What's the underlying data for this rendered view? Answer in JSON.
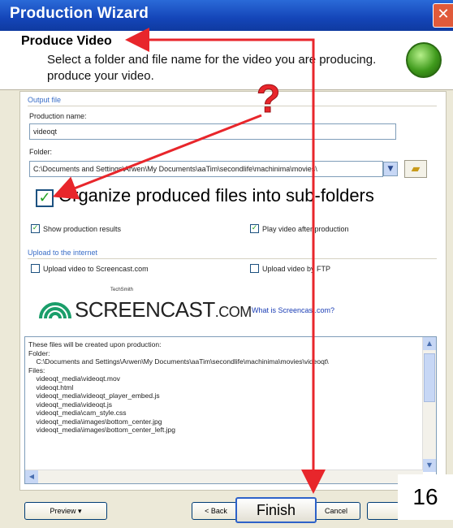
{
  "window": {
    "title": "Production Wizard",
    "close_glyph": "✕"
  },
  "header": {
    "title": "Produce Video",
    "subtitle": "Select a folder and file name for the video you are producing. produce your video."
  },
  "output_file": {
    "group_label": "Output file",
    "production_name_label": "Production name:",
    "production_name_value": "videoqt",
    "folder_label": "Folder:",
    "folder_value": "C:\\Documents and Settings\\Arwen\\My Documents\\aaTim\\secondlife\\machinima\\movies\\",
    "organize_label": "Organize produced files into sub-folders",
    "organize_checked": true,
    "show_results_label": "Show production results",
    "show_results_checked": true,
    "play_after_label": "Play video after production",
    "play_after_checked": true
  },
  "upload": {
    "group_label": "Upload to the internet",
    "screencast_label": "Upload video to Screencast.com",
    "screencast_checked": false,
    "ftp_label": "Upload video by FTP",
    "ftp_checked": false,
    "logo_by": "TechSmith",
    "logo_word": "SCREENCAST",
    "logo_suffix": ".COM",
    "what_link": "What is Screencast.com?"
  },
  "files_box": {
    "lines": [
      "These files will be created upon production:",
      "Folder:",
      "    C:\\Documents and Settings\\Arwen\\My Documents\\aaTim\\secondlife\\machinima\\movies\\videoqt\\",
      "Files:",
      "    videoqt_media\\videoqt.mov",
      "    videoqt.html",
      "    videoqt_media\\videoqt_player_embed.js",
      "    videoqt_media\\videoqt.js",
      "    videoqt_media\\cam_style.css",
      "    videoqt_media\\images\\bottom_center.jpg",
      "    videoqt_media\\images\\bottom_center_left.jpg"
    ]
  },
  "buttons": {
    "preview": "Preview",
    "back": "< Back",
    "finish": "Finish",
    "cancel": "Cancel"
  },
  "annotation": {
    "question_mark": "?",
    "page_number": "16",
    "arrow_color": "#e8262b"
  }
}
